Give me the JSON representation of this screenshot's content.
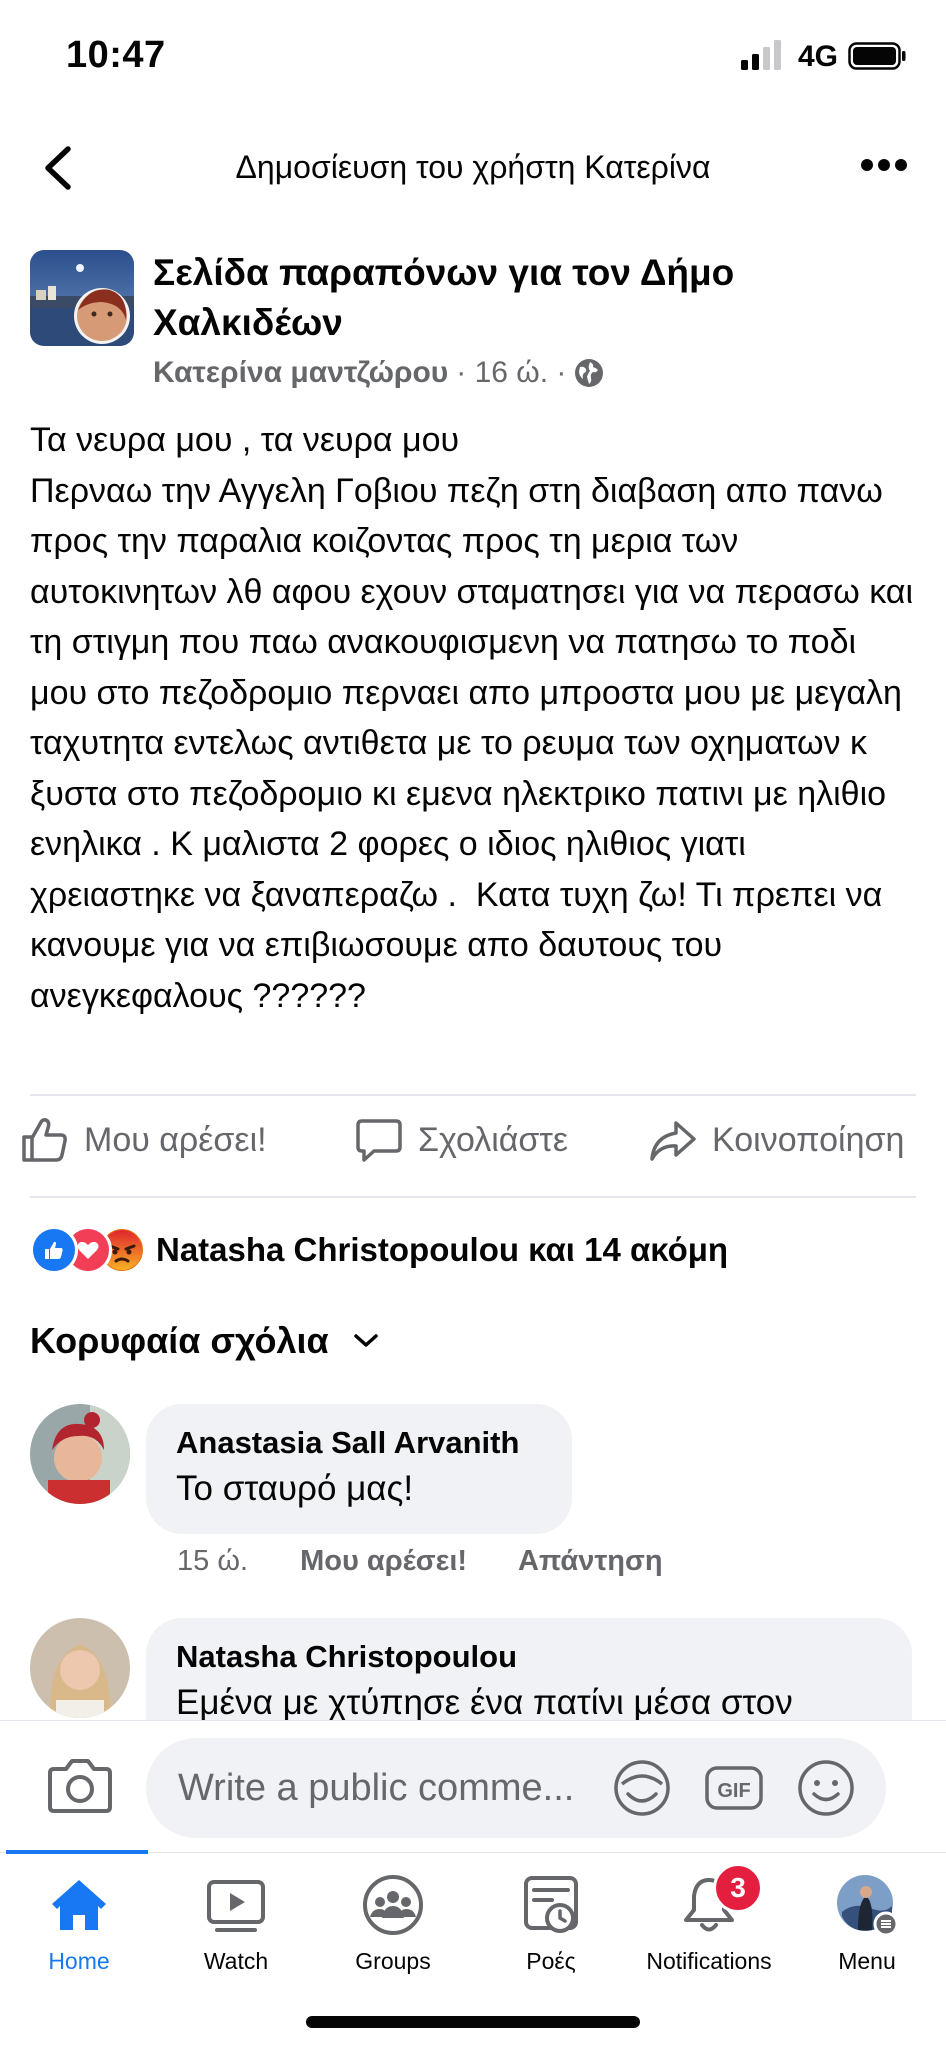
{
  "status_bar": {
    "time": "10:47",
    "network": "4G"
  },
  "header": {
    "title": "Δημοσίευση του χρήστη Κατερίνα"
  },
  "post": {
    "page_name": "Σελίδα παραπόνων για τον  Δήμο Χαλκιδέων",
    "author": "Κατερίνα μαντζώρου",
    "time": "· 16 ώ. ·",
    "body": "Τα νευρα μου , τα νευρα μου\nΠερναω την Αγγελη Γοβιου πεζη στη διαβαση απο πανω προς την παραλια κοιζοντας προς τη μερια των αυτοκινητων λθ αφου εχουν σταματησει για να περασω και τη στιγμη που παω ανακουφισμενη να πατησω το ποδι μου στο πεζοδρομιο περναει απο μπροστα μου με μεγαλη ταχυτητα εντελως αντιθετα με το ρευμα των οχηματων κ ξυστα στο πεζοδρομιο κι εμενα ηλεκτρικο πατινι με ηλιθιο ενηλικα . Κ μαλιστα 2 φορες ο ιδιος ηλιθιος γιατι χρειαστηκε να ξαναπεραζω .  Κατα τυχη ζω! Τι πρεπει να κανουμε για να επιβιωσουμε απο δαυτους του ανεγκεφαλους ??????"
  },
  "actions": {
    "like": "Μου αρέσει!",
    "comment": "Σχολιάστε",
    "share": "Κοινοποίηση"
  },
  "reactions": {
    "summary": "Natasha Christopoulou και 14 ακόμη",
    "types": [
      "like",
      "love",
      "angry"
    ]
  },
  "comments_header": "Κορυφαία σχόλια",
  "comments": [
    {
      "name": "Anastasia Sall Arvanith",
      "text": "Το σταυρό μας!",
      "time": "15 ώ.",
      "like": "Μου αρέσει!",
      "reply": "Απάντηση"
    },
    {
      "name": "Natasha Christopoulou",
      "text": "Εμένα με χτύπησε ένα πατίνι μέσα στον"
    }
  ],
  "composer": {
    "placeholder": "Write a public comme..."
  },
  "tabs": [
    {
      "label": "Home",
      "icon": "home-icon"
    },
    {
      "label": "Watch",
      "icon": "watch-icon"
    },
    {
      "label": "Groups",
      "icon": "groups-icon"
    },
    {
      "label": "Ροές",
      "icon": "feeds-icon"
    },
    {
      "label": "Notifications",
      "icon": "bell-icon",
      "badge": "3"
    },
    {
      "label": "Menu",
      "icon": "avatar-menu-icon"
    }
  ],
  "colors": {
    "accent": "#1877f2",
    "secondary_text": "#65676b",
    "badge": "#e41e3f"
  }
}
